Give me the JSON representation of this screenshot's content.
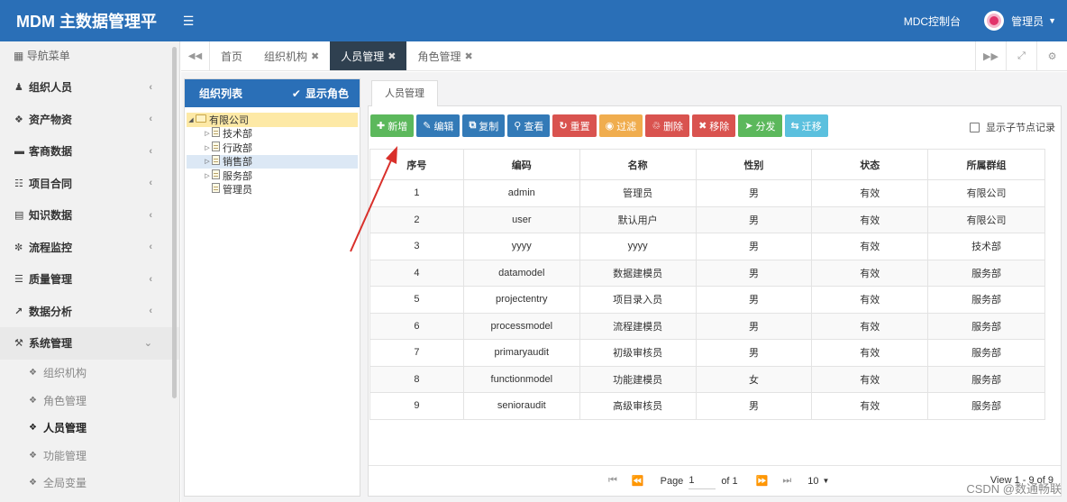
{
  "header": {
    "brand": "MDM 主数据管理平",
    "menu_icon": "hamburger-icon",
    "console_link": "MDC控制台",
    "user_name": "管理员",
    "colors": {
      "header_bg": "#2a6fb7"
    }
  },
  "sidebar": {
    "nav_header": "导航菜单",
    "items": [
      {
        "label": "组织人员",
        "icon": "users-icon"
      },
      {
        "label": "资产物资",
        "icon": "cubes-icon"
      },
      {
        "label": "客商数据",
        "icon": "card-icon"
      },
      {
        "label": "项目合同",
        "icon": "sitemap-icon"
      },
      {
        "label": "知识数据",
        "icon": "book-icon"
      },
      {
        "label": "流程监控",
        "icon": "spinner-icon"
      },
      {
        "label": "质量管理",
        "icon": "list-icon"
      },
      {
        "label": "数据分析",
        "icon": "chart-icon"
      },
      {
        "label": "系统管理",
        "icon": "wrench-icon"
      }
    ],
    "sub_items": [
      {
        "label": "组织机构"
      },
      {
        "label": "角色管理"
      },
      {
        "label": "人员管理"
      },
      {
        "label": "功能管理"
      },
      {
        "label": "全局变量"
      }
    ]
  },
  "tabs": [
    {
      "label": "首页"
    },
    {
      "label": "组织机构"
    },
    {
      "label": "人员管理"
    },
    {
      "label": "角色管理"
    }
  ],
  "org_panel": {
    "title": "组织列表",
    "show_role": "显示角色",
    "tree": {
      "root": "有限公司",
      "children": [
        "技术部",
        "行政部",
        "销售部",
        "服务部",
        "管理员"
      ]
    }
  },
  "main": {
    "tab_label": "人员管理",
    "buttons": {
      "add": "新增",
      "edit": "编辑",
      "copy": "复制",
      "view": "查看",
      "reset": "重置",
      "filter": "过滤",
      "delete": "删除",
      "remove": "移除",
      "assign": "分发",
      "migrate": "迁移"
    },
    "show_child_records": "显示子节点记录",
    "table": {
      "headers": [
        "序号",
        "编码",
        "名称",
        "性别",
        "状态",
        "所属群组"
      ],
      "rows": [
        [
          "1",
          "admin",
          "管理员",
          "男",
          "有效",
          "有限公司"
        ],
        [
          "2",
          "user",
          "默认用户",
          "男",
          "有效",
          "有限公司"
        ],
        [
          "3",
          "yyyy",
          "yyyy",
          "男",
          "有效",
          "技术部"
        ],
        [
          "4",
          "datamodel",
          "数据建模员",
          "男",
          "有效",
          "服务部"
        ],
        [
          "5",
          "projectentry",
          "项目录入员",
          "男",
          "有效",
          "服务部"
        ],
        [
          "6",
          "processmodel",
          "流程建模员",
          "男",
          "有效",
          "服务部"
        ],
        [
          "7",
          "primaryaudit",
          "初级审核员",
          "男",
          "有效",
          "服务部"
        ],
        [
          "8",
          "functionmodel",
          "功能建模员",
          "女",
          "有效",
          "服务部"
        ],
        [
          "9",
          "senioraudit",
          "高级审核员",
          "男",
          "有效",
          "服务部"
        ]
      ]
    },
    "pager": {
      "page_label": "Page",
      "page_value": "1",
      "of_label": "of 1",
      "page_size": "10",
      "view_info": "View 1 - 9 of 9"
    }
  },
  "watermark": "CSDN @数通畅联"
}
